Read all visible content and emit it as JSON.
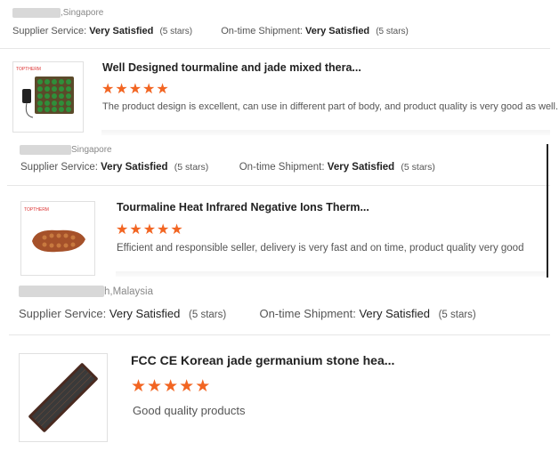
{
  "reviews": [
    {
      "location": ",Singapore",
      "supplier_label": "Supplier Service:",
      "supplier_value": "Very Satisfied",
      "supplier_stars": "(5 stars)",
      "shipment_label": "On-time Shipment:",
      "shipment_value": "Very Satisfied",
      "shipment_stars": "(5 stars)",
      "product_title": "Well Designed tourmaline and jade mixed thera...",
      "rating": 5,
      "comment": "The product design is excellent, can use in different part of body, and product quality is very good as well."
    },
    {
      "location": "Singapore",
      "supplier_label": "Supplier Service:",
      "supplier_value": "Very Satisfied",
      "supplier_stars": "(5 stars)",
      "shipment_label": "On-time Shipment:",
      "shipment_value": "Very Satisfied",
      "shipment_stars": "(5 stars)",
      "product_title": "Tourmaline Heat Infrared Negative Ions Therm...",
      "rating": 5,
      "comment": "Efficient and responsible seller, delivery is very fast and on time, product quality very good"
    },
    {
      "location": "h,Malaysia",
      "supplier_label": "Supplier Service:",
      "supplier_value": "Very Satisfied",
      "supplier_stars": "(5 stars)",
      "shipment_label": "On-time Shipment:",
      "shipment_value": "Very Satisfied",
      "shipment_stars": "(5 stars)",
      "product_title": "FCC CE Korean jade germanium stone hea...",
      "rating": 5,
      "comment": "Good quality products"
    }
  ],
  "colors": {
    "star": "#f26522"
  },
  "icons": {
    "star": "star-icon"
  }
}
